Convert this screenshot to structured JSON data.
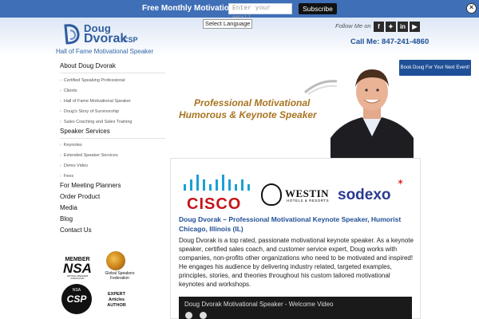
{
  "topbar": {
    "promo": "Free Monthly Motivation!",
    "email_placeholder": "Enter your email",
    "subscribe": "Subscribe"
  },
  "header": {
    "logo_line1": "Doug",
    "logo_line2": "Dvorak",
    "logo_suffix": "CSP",
    "tagline": "Hall of Fame Motivational Speaker",
    "language_select": "Select Language",
    "follow_label": "Follow Me on",
    "social": [
      "f",
      "t",
      "in",
      "yt"
    ],
    "phone": "Call Me: 847-241-4860"
  },
  "book_button": "Book Doug For Your Next Event!",
  "nav": [
    {
      "label": "About Doug Dvorak",
      "children": [
        "Certified Speaking Professional",
        "Clients",
        "Hall of Fame Motivational Speaker",
        "Doug's Story of Survivorship",
        "Sales Coaching and Sales Training"
      ]
    },
    {
      "label": "Speaker Services",
      "children": [
        "Keynotes",
        "Extended Speaker Services",
        "Demo Video",
        "Fees"
      ]
    },
    {
      "label": "For Meeting Planners",
      "children": []
    },
    {
      "label": "Order Product",
      "children": []
    },
    {
      "label": "Media",
      "children": []
    },
    {
      "label": "Blog",
      "children": []
    },
    {
      "label": "Contact Us",
      "children": []
    }
  ],
  "hero": {
    "line1": "Professional Motivational",
    "line2": "Humorous & Keynote Speaker"
  },
  "clients": {
    "cisco": "CISCO",
    "westin": "WESTIN",
    "westin_sub": "HOTELS & RESORTS",
    "sodexo": "sodexo"
  },
  "content": {
    "title": "Doug Dvorak – Professional Motivational Keynote Speaker, Humorist Chicago, Illinois (IL)",
    "body": "Doug Dvorak is a top rated, passionate motivational keynote speaker. As a keynote speaker, certified sales coach, and customer service expert, Doug works with companies, non-profits other organizations who need to be motivated and inspired! He engages his audience by delivering industry related, targeted examples, principles, stories, and theories throughout his custom tailored motivational keynotes and workshops.",
    "video_title": "Doug Dvorak Motivational Speaker - Welcome Video"
  },
  "badges": {
    "nsa_member": "MEMBER",
    "nsa": "NSA",
    "nsa_sub": "NATIONAL SPEAKERS ASSOCIATION",
    "gsf": "Global Speakers Federation",
    "csp": "CSP",
    "csp_top": "NSA",
    "expert": "EXPERT Articles AUTHOR"
  },
  "colors": {
    "topbar": "#3f6fb6",
    "brand_blue": "#1f4f96",
    "hero_gold": "#a87420",
    "cisco_red": "#c4161c",
    "sodexo_blue": "#2a3a8f"
  }
}
